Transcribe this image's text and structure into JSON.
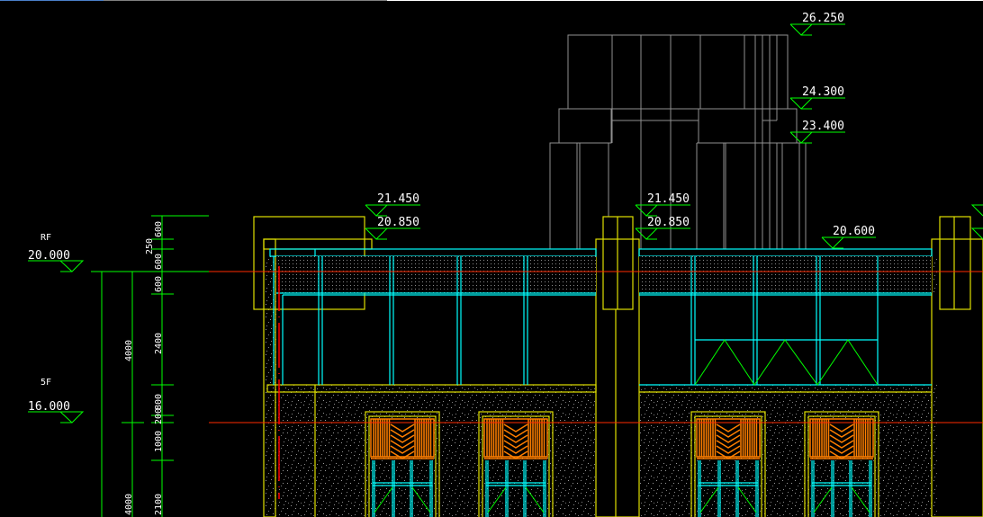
{
  "levels": [
    {
      "name": "RF",
      "elevation": "20.000"
    },
    {
      "name": "5F",
      "elevation": "16.000"
    }
  ],
  "elevation_marks": {
    "top": "26.250",
    "upper": "24.300",
    "mid": "23.400",
    "parapet_top_left": "21.450",
    "parapet_base_left": "20.850",
    "parapet_top_right": "21.450",
    "parapet_base_right": "20.850",
    "roof": "20.600"
  },
  "dimensions": {
    "outer": [
      "4000",
      "4000"
    ],
    "inner": [
      "600",
      "250",
      "600",
      "600",
      "2400",
      "800",
      "200",
      "1000",
      "2100"
    ]
  },
  "colors": {
    "dimension": "#00ff00",
    "structure": "#e0e000",
    "glazing": "#00ffff",
    "axis": "#ff2a00",
    "grille": "#ff7f00",
    "outline": "#909090"
  }
}
